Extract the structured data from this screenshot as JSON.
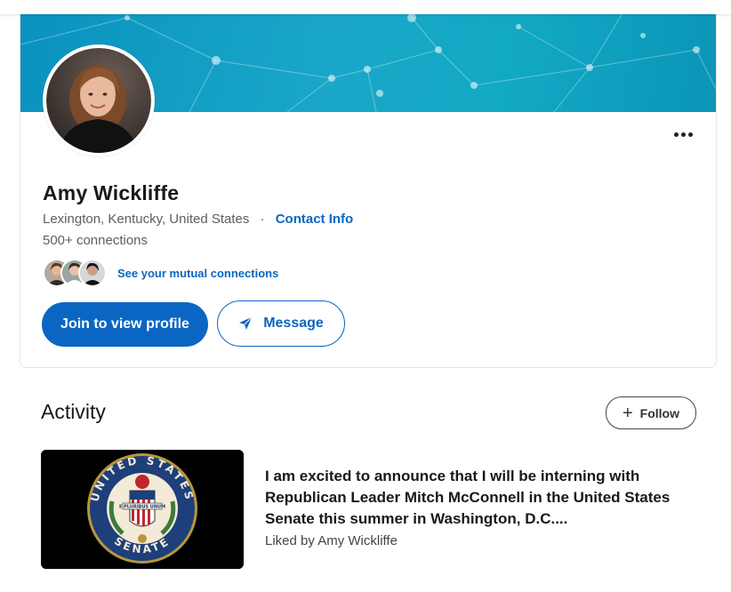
{
  "profile": {
    "name": "Amy Wickliffe",
    "location": "Lexington, Kentucky, United States",
    "separator": "·",
    "contact_label": "Contact Info",
    "connections": "500+ connections",
    "mutual_label": "See your mutual connections",
    "more_icon": "more-horizontal-icon"
  },
  "actions": {
    "join_label": "Join to view profile",
    "message_label": "Message",
    "message_icon": "send-icon"
  },
  "activity": {
    "title": "Activity",
    "follow_label": "Follow",
    "follow_icon": "plus-icon",
    "posts": [
      {
        "text": "I am excited to announce that I will be interning with Republican Leader Mitch McConnell in the United States Senate this summer in Washington, D.C....",
        "meta": "Liked by Amy Wickliffe",
        "image_seal_text": "UNITED STATES SENATE",
        "image_motto": "E PLURIBUS UNUM"
      }
    ]
  },
  "colors": {
    "accent": "#0a66c2",
    "banner": "#12a9c4",
    "text_secondary": "#5e5e5e"
  }
}
